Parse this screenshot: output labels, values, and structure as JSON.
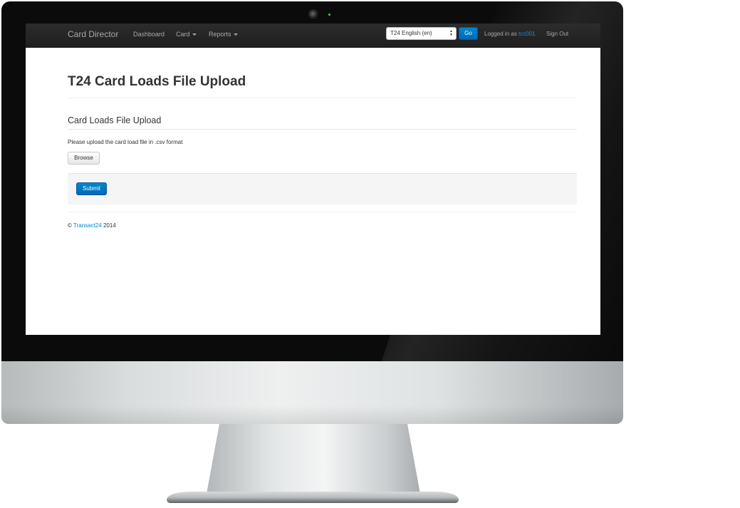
{
  "navbar": {
    "brand": "Card Director",
    "items": [
      {
        "label": "Dashboard"
      },
      {
        "label": "Card"
      },
      {
        "label": "Reports"
      }
    ],
    "language_select": {
      "value": "T24 English (en)"
    },
    "go_label": "Go",
    "logged_in_prefix": "Logged in as",
    "username": "tcc001",
    "sign_out": "Sign Out"
  },
  "page": {
    "title": "T24 Card Loads File Upload",
    "section_title": "Card Loads File Upload",
    "help_text": "Please upload the card load file in .csv format",
    "browse_label": "Browse",
    "submit_label": "Submit"
  },
  "footer": {
    "copyright_symbol": "©",
    "company": "Transact24",
    "year": "2014"
  },
  "colors": {
    "accent": "#0088cc",
    "navbar_bg": "#222222",
    "form_actions_bg": "#f5f5f5"
  },
  "icons": {
    "caret": "chevron-down-icon",
    "select_arrows": "select-arrows-icon"
  }
}
